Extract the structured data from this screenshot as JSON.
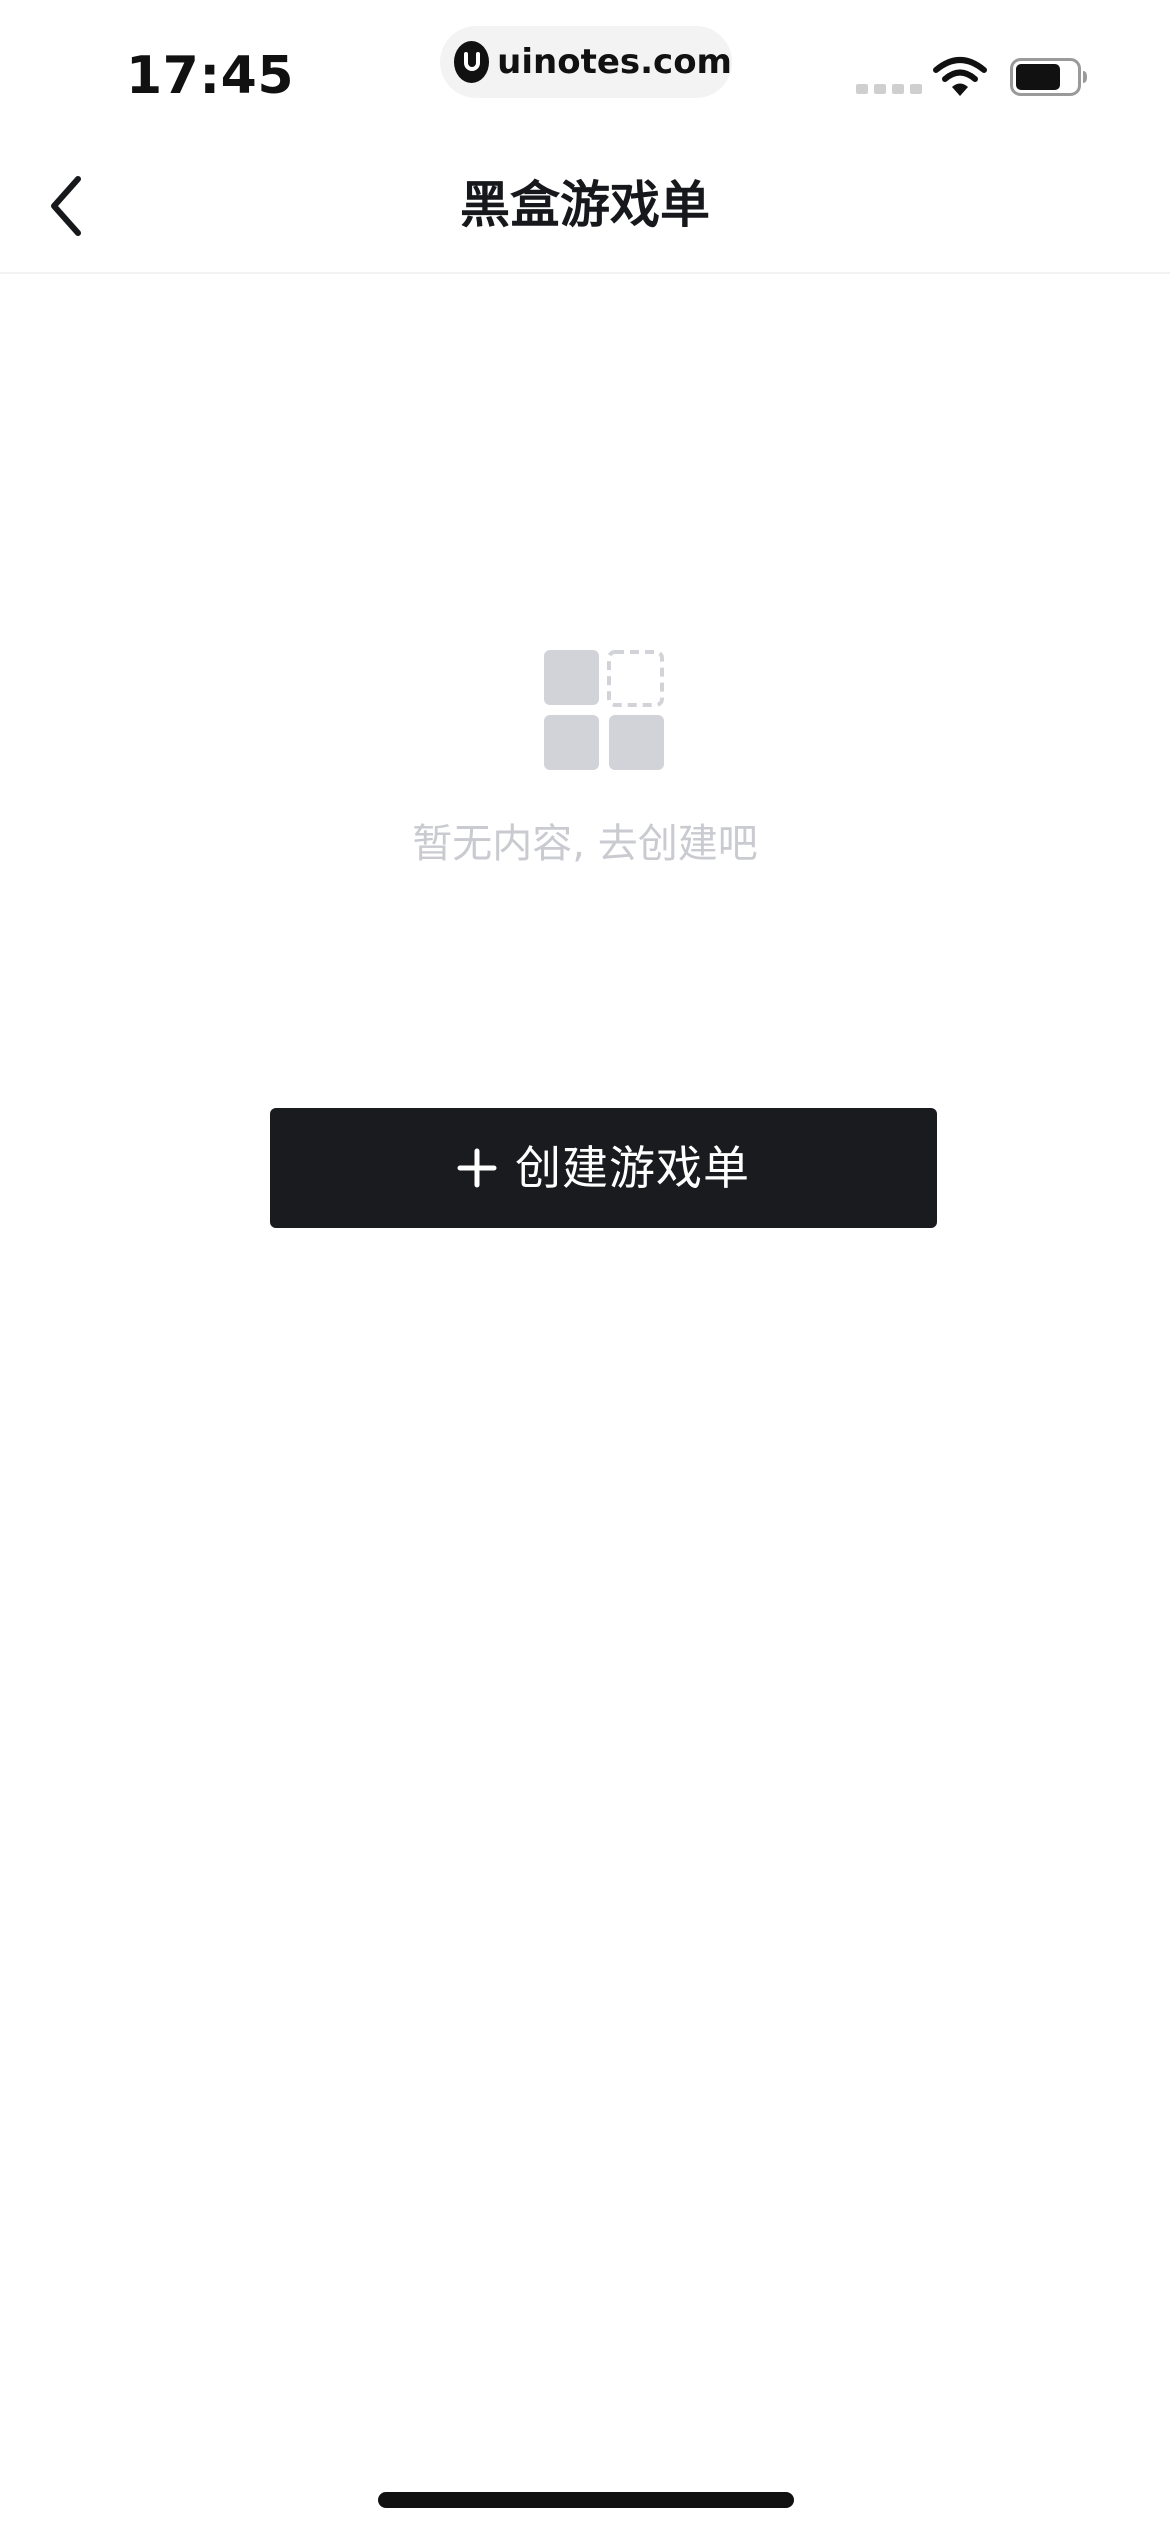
{
  "status_bar": {
    "time": "17:45",
    "url": "uinotes.com",
    "icons": [
      "signal-icon",
      "wifi-icon",
      "battery-icon"
    ]
  },
  "nav": {
    "back_icon": "chevron-left-icon",
    "title": "黑盒游戏单"
  },
  "empty_state": {
    "icon": "empty-grid-icon",
    "message": "暂无内容, 去创建吧"
  },
  "create_button": {
    "icon": "plus-icon",
    "label": "创建游戏单"
  },
  "colors": {
    "background": "#ffffff",
    "title_text": "#16181b",
    "button_bg": "#1a1b1e",
    "button_text": "#ffffff",
    "empty_text": "#c9cbd0",
    "empty_icon": "#d1d3d8"
  }
}
